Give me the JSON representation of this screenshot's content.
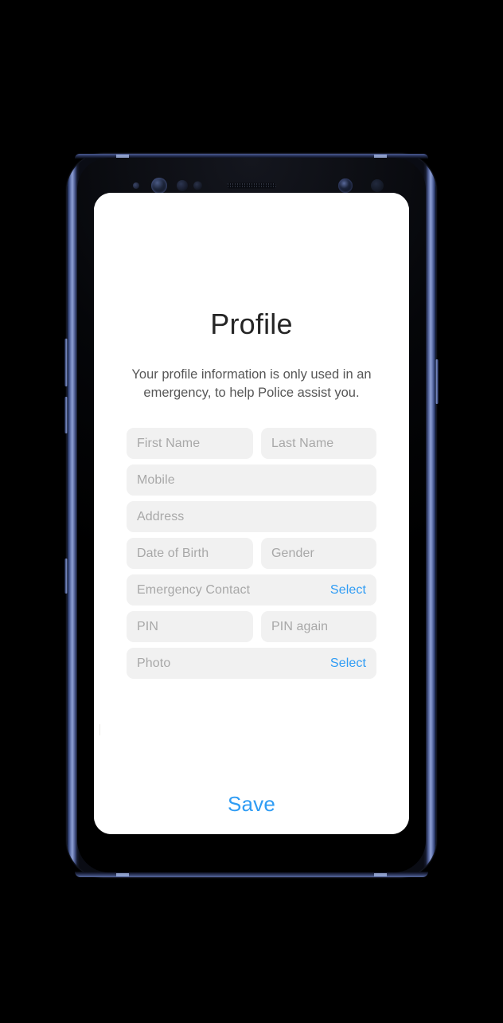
{
  "device": {
    "type": "smartphone-mockup",
    "frame_color": "#2e3f73",
    "body_color": "#05060a",
    "screen_background": "#ffffff",
    "buttons": {
      "volume_up": "volume-up-button",
      "volume_down": "volume-down-button",
      "assistant": "assistant-button",
      "power": "power-button"
    },
    "sensors": {
      "indicator": "indicator-led",
      "iris_scanner": "iris-scanner",
      "proximity": "proximity-sensor",
      "light": "light-sensor",
      "earpiece": "earpiece-speaker",
      "front_camera": "front-camera",
      "extra": "secondary-sensor"
    }
  },
  "app": {
    "title": "Profile",
    "subtitle": "Your profile information is only used in an emergency, to help Police assist you.",
    "accent_color": "#2f9cf4",
    "field_background": "#f1f1f1",
    "placeholder_color": "#a8a8a8",
    "rows": [
      {
        "layout": "split",
        "fields": [
          {
            "name": "first-name",
            "placeholder": "First Name",
            "value": "",
            "action": null
          },
          {
            "name": "last-name",
            "placeholder": "Last Name",
            "value": "",
            "action": null
          }
        ]
      },
      {
        "layout": "full",
        "fields": [
          {
            "name": "mobile",
            "placeholder": "Mobile",
            "value": "",
            "action": null
          }
        ]
      },
      {
        "layout": "full",
        "fields": [
          {
            "name": "address",
            "placeholder": "Address",
            "value": "",
            "action": null
          }
        ]
      },
      {
        "layout": "split",
        "fields": [
          {
            "name": "date-of-birth",
            "placeholder": "Date of Birth",
            "value": "",
            "action": null
          },
          {
            "name": "gender",
            "placeholder": "Gender",
            "value": "",
            "action": null
          }
        ]
      },
      {
        "layout": "full",
        "fields": [
          {
            "name": "emergency-contact",
            "placeholder": "Emergency Contact",
            "value": "",
            "action": "Select"
          }
        ]
      },
      {
        "layout": "split",
        "fields": [
          {
            "name": "pin",
            "placeholder": "PIN",
            "value": "",
            "action": null
          },
          {
            "name": "pin-again",
            "placeholder": "PIN again",
            "value": "",
            "action": null
          }
        ]
      },
      {
        "layout": "full",
        "fields": [
          {
            "name": "photo",
            "placeholder": "Photo",
            "value": "",
            "action": "Select"
          }
        ]
      }
    ],
    "save_label": "Save"
  }
}
